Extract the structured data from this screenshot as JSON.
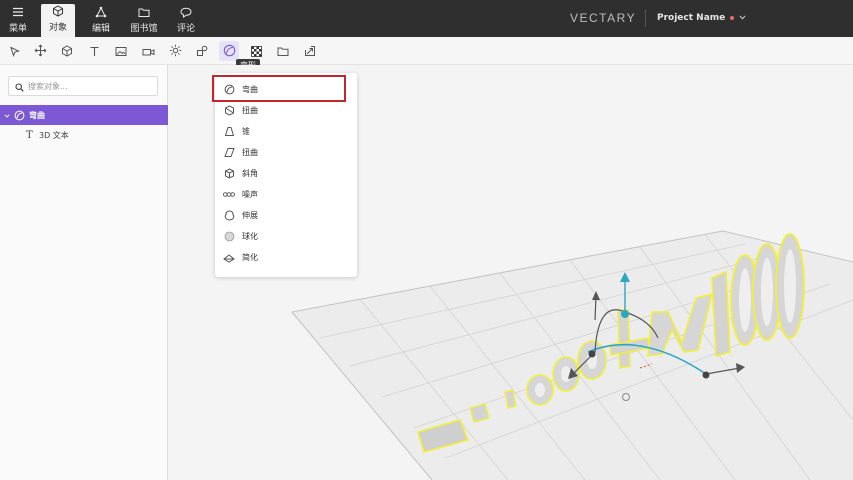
{
  "topbar": {
    "nav": [
      {
        "key": "menu",
        "label": "菜单",
        "icon": "hamburger-icon"
      },
      {
        "key": "object",
        "label": "对象",
        "icon": "cube-icon",
        "active": true
      },
      {
        "key": "edit",
        "label": "编辑",
        "icon": "vertex-edit-icon"
      },
      {
        "key": "library",
        "label": "图书馆",
        "icon": "folder-icon"
      },
      {
        "key": "comment",
        "label": "评论",
        "icon": "speech-bubble-icon"
      }
    ],
    "brand": "VECTARY",
    "project_name": "Project Name",
    "status_color": "#e86d6d"
  },
  "toolbar": {
    "tools": [
      "select-arrow-icon",
      "move-gizmo-icon",
      "cube-icon",
      "text-tool-icon",
      "image-icon",
      "camera-icon",
      "light-sun-icon",
      "shapes-icon",
      "deformer-icon",
      "checker-pattern-icon",
      "folder-icon",
      "export-icon"
    ],
    "active_tool": "deformer-icon",
    "tooltip": "变形",
    "accent": "#7c58d4"
  },
  "left_panel": {
    "search_placeholder": "搜索对象...",
    "tree": {
      "selected_label": "弯曲",
      "child_label": "3D 文本"
    }
  },
  "dropdown": {
    "items": [
      {
        "label": "弯曲",
        "icon": "bend-icon"
      },
      {
        "label": "扭曲",
        "icon": "twist-icon"
      },
      {
        "label": "锥",
        "icon": "taper-icon"
      },
      {
        "label": "扭曲",
        "icon": "skew-icon"
      },
      {
        "label": "斜角",
        "icon": "bevel-icon"
      },
      {
        "label": "噪声",
        "icon": "noise-icon"
      },
      {
        "label": "伸展",
        "icon": "stretch-icon"
      },
      {
        "label": "球化",
        "icon": "spherify-icon"
      },
      {
        "label": "简化",
        "icon": "simplify-icon"
      }
    ],
    "highlight_color": "#c0262b"
  },
  "viewport": {
    "object_text": "1.000dpi-W1000",
    "selection_color": "#f3ef3b"
  }
}
